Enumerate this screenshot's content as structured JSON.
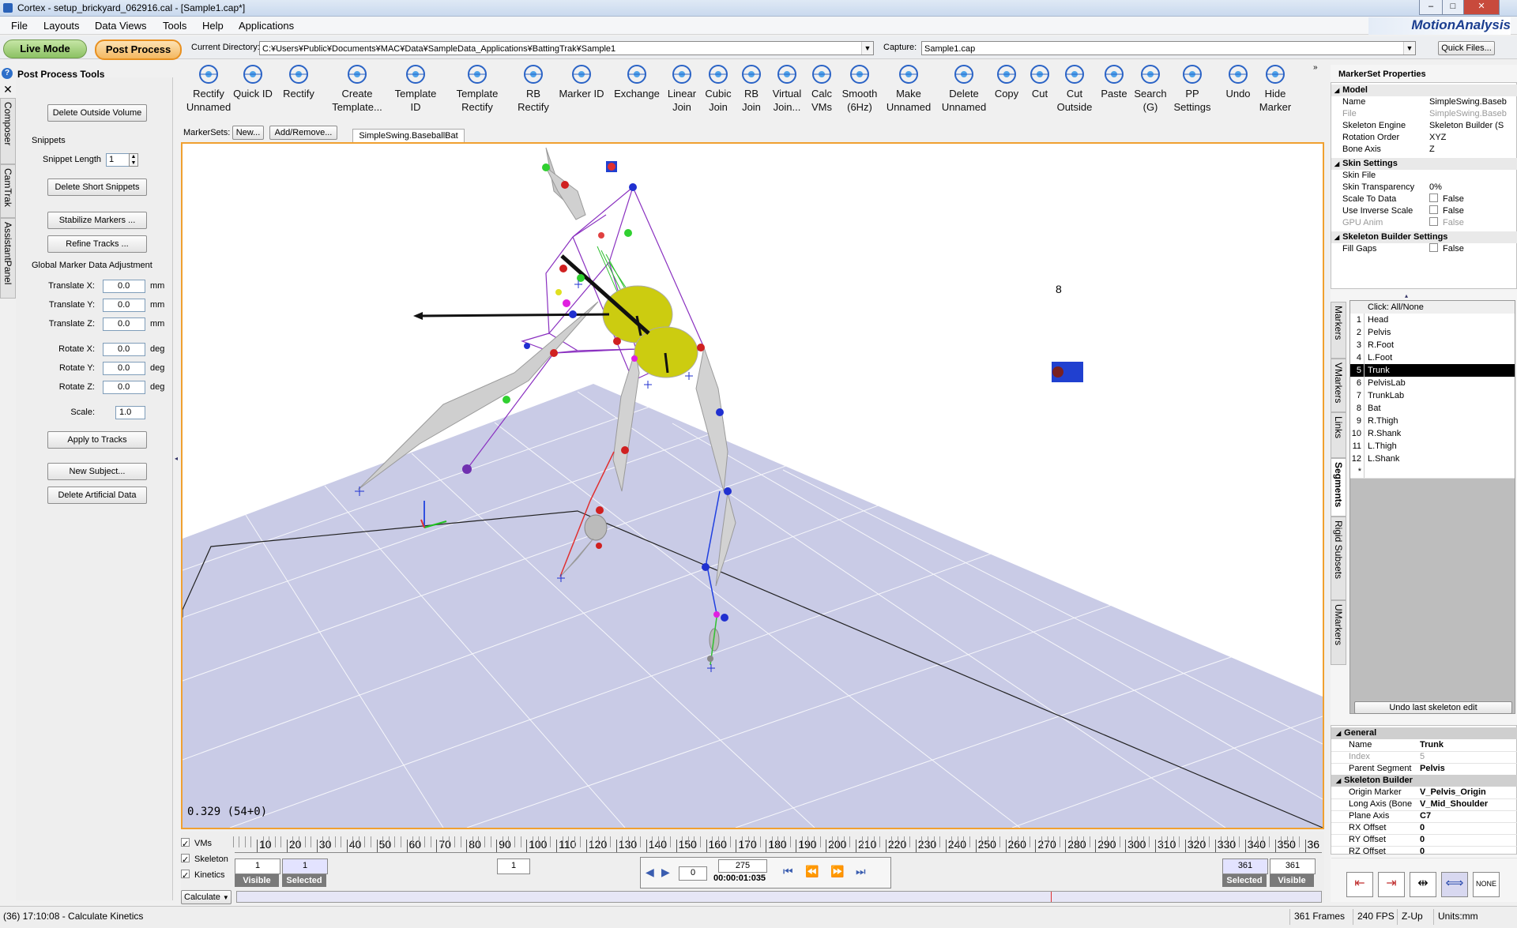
{
  "window": {
    "title": "Cortex - setup_brickyard_062916.cal - [Sample1.cap*]"
  },
  "menu": [
    "File",
    "Layouts",
    "Data Views",
    "Tools",
    "Help",
    "Applications"
  ],
  "logo": "MotionAnalysis",
  "modes": {
    "live": "Live Mode",
    "post": "Post Process"
  },
  "directory": {
    "label": "Current Directory:",
    "value": "C:¥Users¥Public¥Documents¥MAC¥Data¥SampleData_Applications¥BattingTrak¥Sample1"
  },
  "capture": {
    "label": "Capture:",
    "value": "Sample1.cap",
    "quick_files": "Quick Files..."
  },
  "left_panel": {
    "title": "Post Process Tools",
    "delete_outside": "Delete Outside Volume",
    "snippets": "Snippets",
    "snippet_length_label": "Snippet Length",
    "snippet_length_value": "1",
    "delete_short": "Delete Short Snippets",
    "stabilize": "Stabilize Markers ...",
    "refine": "Refine Tracks ...",
    "global_adj": "Global Marker Data Adjustment",
    "fields": [
      {
        "label": "Translate X:",
        "value": "0.0",
        "unit": "mm"
      },
      {
        "label": "Translate Y:",
        "value": "0.0",
        "unit": "mm"
      },
      {
        "label": "Translate Z:",
        "value": "0.0",
        "unit": "mm"
      },
      {
        "label": "Rotate X:",
        "value": "0.0",
        "unit": "deg"
      },
      {
        "label": "Rotate Y:",
        "value": "0.0",
        "unit": "deg"
      },
      {
        "label": "Rotate Z:",
        "value": "0.0",
        "unit": "deg"
      },
      {
        "label": "Scale:",
        "value": "1.0",
        "unit": ""
      }
    ],
    "apply": "Apply to Tracks",
    "new_subject": "New Subject...",
    "delete_artificial": "Delete Artificial Data"
  },
  "side_tabs": [
    "Composer",
    "CamTrak",
    "AssistantPanel"
  ],
  "toolbar": [
    {
      "l1": "Rectify",
      "l2": "Unnamed",
      "icon": "rectify-unnamed-icon"
    },
    {
      "l1": "Quick ID",
      "l2": "",
      "icon": "quick-id-icon"
    },
    {
      "l1": "Rectify",
      "l2": "",
      "icon": "rectify-icon"
    },
    {
      "l1": "Create",
      "l2": "Template...",
      "icon": "create-template-icon"
    },
    {
      "l1": "Template",
      "l2": "ID",
      "icon": "template-id-icon"
    },
    {
      "l1": "Template",
      "l2": "Rectify",
      "icon": "template-rectify-icon"
    },
    {
      "l1": "RB",
      "l2": "Rectify",
      "icon": "rb-rectify-icon"
    },
    {
      "l1": "Marker ID",
      "l2": "",
      "icon": "marker-id-icon"
    },
    {
      "l1": "Exchange",
      "l2": "",
      "icon": "exchange-icon"
    },
    {
      "l1": "Linear",
      "l2": "Join",
      "icon": "linear-join-icon"
    },
    {
      "l1": "Cubic",
      "l2": "Join",
      "icon": "cubic-join-icon"
    },
    {
      "l1": "RB",
      "l2": "Join",
      "icon": "rb-join-icon"
    },
    {
      "l1": "Virtual",
      "l2": "Join...",
      "icon": "virtual-join-icon"
    },
    {
      "l1": "Calc",
      "l2": "VMs",
      "icon": "calc-vms-icon"
    },
    {
      "l1": "Smooth",
      "l2": "(6Hz)",
      "icon": "smooth-icon"
    },
    {
      "l1": "Make",
      "l2": "Unnamed",
      "icon": "make-unnamed-icon"
    },
    {
      "l1": "Delete",
      "l2": "Unnamed",
      "icon": "delete-unnamed-icon"
    },
    {
      "l1": "Copy",
      "l2": "",
      "icon": "copy-icon"
    },
    {
      "l1": "Cut",
      "l2": "",
      "icon": "cut-icon"
    },
    {
      "l1": "Cut",
      "l2": "Outside",
      "icon": "cut-outside-icon"
    },
    {
      "l1": "Paste",
      "l2": "",
      "icon": "paste-icon"
    },
    {
      "l1": "Search",
      "l2": "(G)",
      "icon": "search-icon"
    },
    {
      "l1": "PP",
      "l2": "Settings",
      "icon": "pp-settings-icon"
    },
    {
      "l1": "Undo",
      "l2": "",
      "icon": "undo-icon"
    },
    {
      "l1": "Hide",
      "l2": "Marker",
      "icon": "hide-marker-icon"
    }
  ],
  "markersets": {
    "label": "MarkerSets:",
    "new": "New...",
    "addremove": "Add/Remove...",
    "tab": "SimpleSwing.BaseballBat"
  },
  "viewport": {
    "readout": "0.329 (54+0)",
    "marker_label": "8"
  },
  "timeline": {
    "ticks": [
      "10",
      "20",
      "30",
      "40",
      "50",
      "60",
      "70",
      "80",
      "90",
      "100",
      "110",
      "120",
      "130",
      "140",
      "150",
      "160",
      "170",
      "180",
      "190",
      "200",
      "210",
      "220",
      "230",
      "240",
      "250",
      "260",
      "270",
      "280",
      "290",
      "300",
      "310",
      "320",
      "330",
      "340",
      "350",
      "36"
    ],
    "checks": [
      "VMs",
      "Skeleton",
      "Kinetics"
    ],
    "left_sel": "1",
    "left_vis": "1",
    "visible": "Visible",
    "selected": "Selected",
    "speed": "0",
    "frame": "275",
    "time": "00:00:01:035",
    "right_sel": "361",
    "right_vis": "361",
    "calculate": "Calculate"
  },
  "markerset_props": {
    "title": "MarkerSet Properties",
    "model": "Model",
    "rows": [
      {
        "k": "Name",
        "v": "SimpleSwing.Baseb",
        "dim": false
      },
      {
        "k": "File",
        "v": "SimpleSwing.Baseb",
        "dim": true
      },
      {
        "k": "Skeleton Engine",
        "v": "Skeleton Builder (S",
        "dim": false
      },
      {
        "k": "Rotation Order",
        "v": "XYZ",
        "dim": false
      },
      {
        "k": "Bone Axis",
        "v": "Z",
        "dim": false
      }
    ],
    "skin": "Skin Settings",
    "skin_rows": [
      {
        "k": "Skin File",
        "v": ""
      },
      {
        "k": "Skin Transparency",
        "v": "0%"
      },
      {
        "k": "Scale To Data",
        "v": "False"
      },
      {
        "k": "Use Inverse Scale",
        "v": "False"
      },
      {
        "k": "GPU Anim",
        "v": "False"
      }
    ],
    "sbs": "Skeleton Builder Settings",
    "sbs_rows": [
      {
        "k": "Fill Gaps",
        "v": "False"
      }
    ]
  },
  "right_tabs": [
    "Markers",
    "VMarkers",
    "Links",
    "Segments",
    "Rigid Subsets",
    "UMarkers"
  ],
  "segments": {
    "header": "Click: All/None",
    "rows": [
      "Head",
      "Pelvis",
      "R.Foot",
      "L.Foot",
      "Trunk",
      "PelvisLab",
      "TrunkLab",
      "Bat",
      "R.Thigh",
      "R.Shank",
      "L.Thigh",
      "L.Shank"
    ],
    "selected_index": 5,
    "undo": "Undo last skeleton edit"
  },
  "segment_props": {
    "general": "General",
    "general_rows": [
      {
        "k": "Name",
        "v": "Trunk"
      },
      {
        "k": "Index",
        "v": "5"
      },
      {
        "k": "Parent Segment",
        "v": "Pelvis"
      }
    ],
    "sb": "Skeleton Builder",
    "sb_rows": [
      {
        "k": "Origin Marker",
        "v": "V_Pelvis_Origin"
      },
      {
        "k": "Long Axis (Bone",
        "v": "V_Mid_Shoulder"
      },
      {
        "k": "Plane Axis",
        "v": "C7"
      },
      {
        "k": "RX Offset",
        "v": "0"
      },
      {
        "k": "RY Offset",
        "v": "0"
      },
      {
        "k": "RZ Offset",
        "v": "0"
      }
    ]
  },
  "status": {
    "msg": "(36) 17:10:08 - Calculate Kinetics",
    "frames": "361 Frames",
    "fps": "240 FPS",
    "zup": "Z-Up",
    "units": "Units:mm"
  },
  "colors": {
    "accent": "#f0a030",
    "live": "#9ccf6e",
    "post": "#f6c77a",
    "floor": "#c9cbe6",
    "selected": "#000000"
  }
}
